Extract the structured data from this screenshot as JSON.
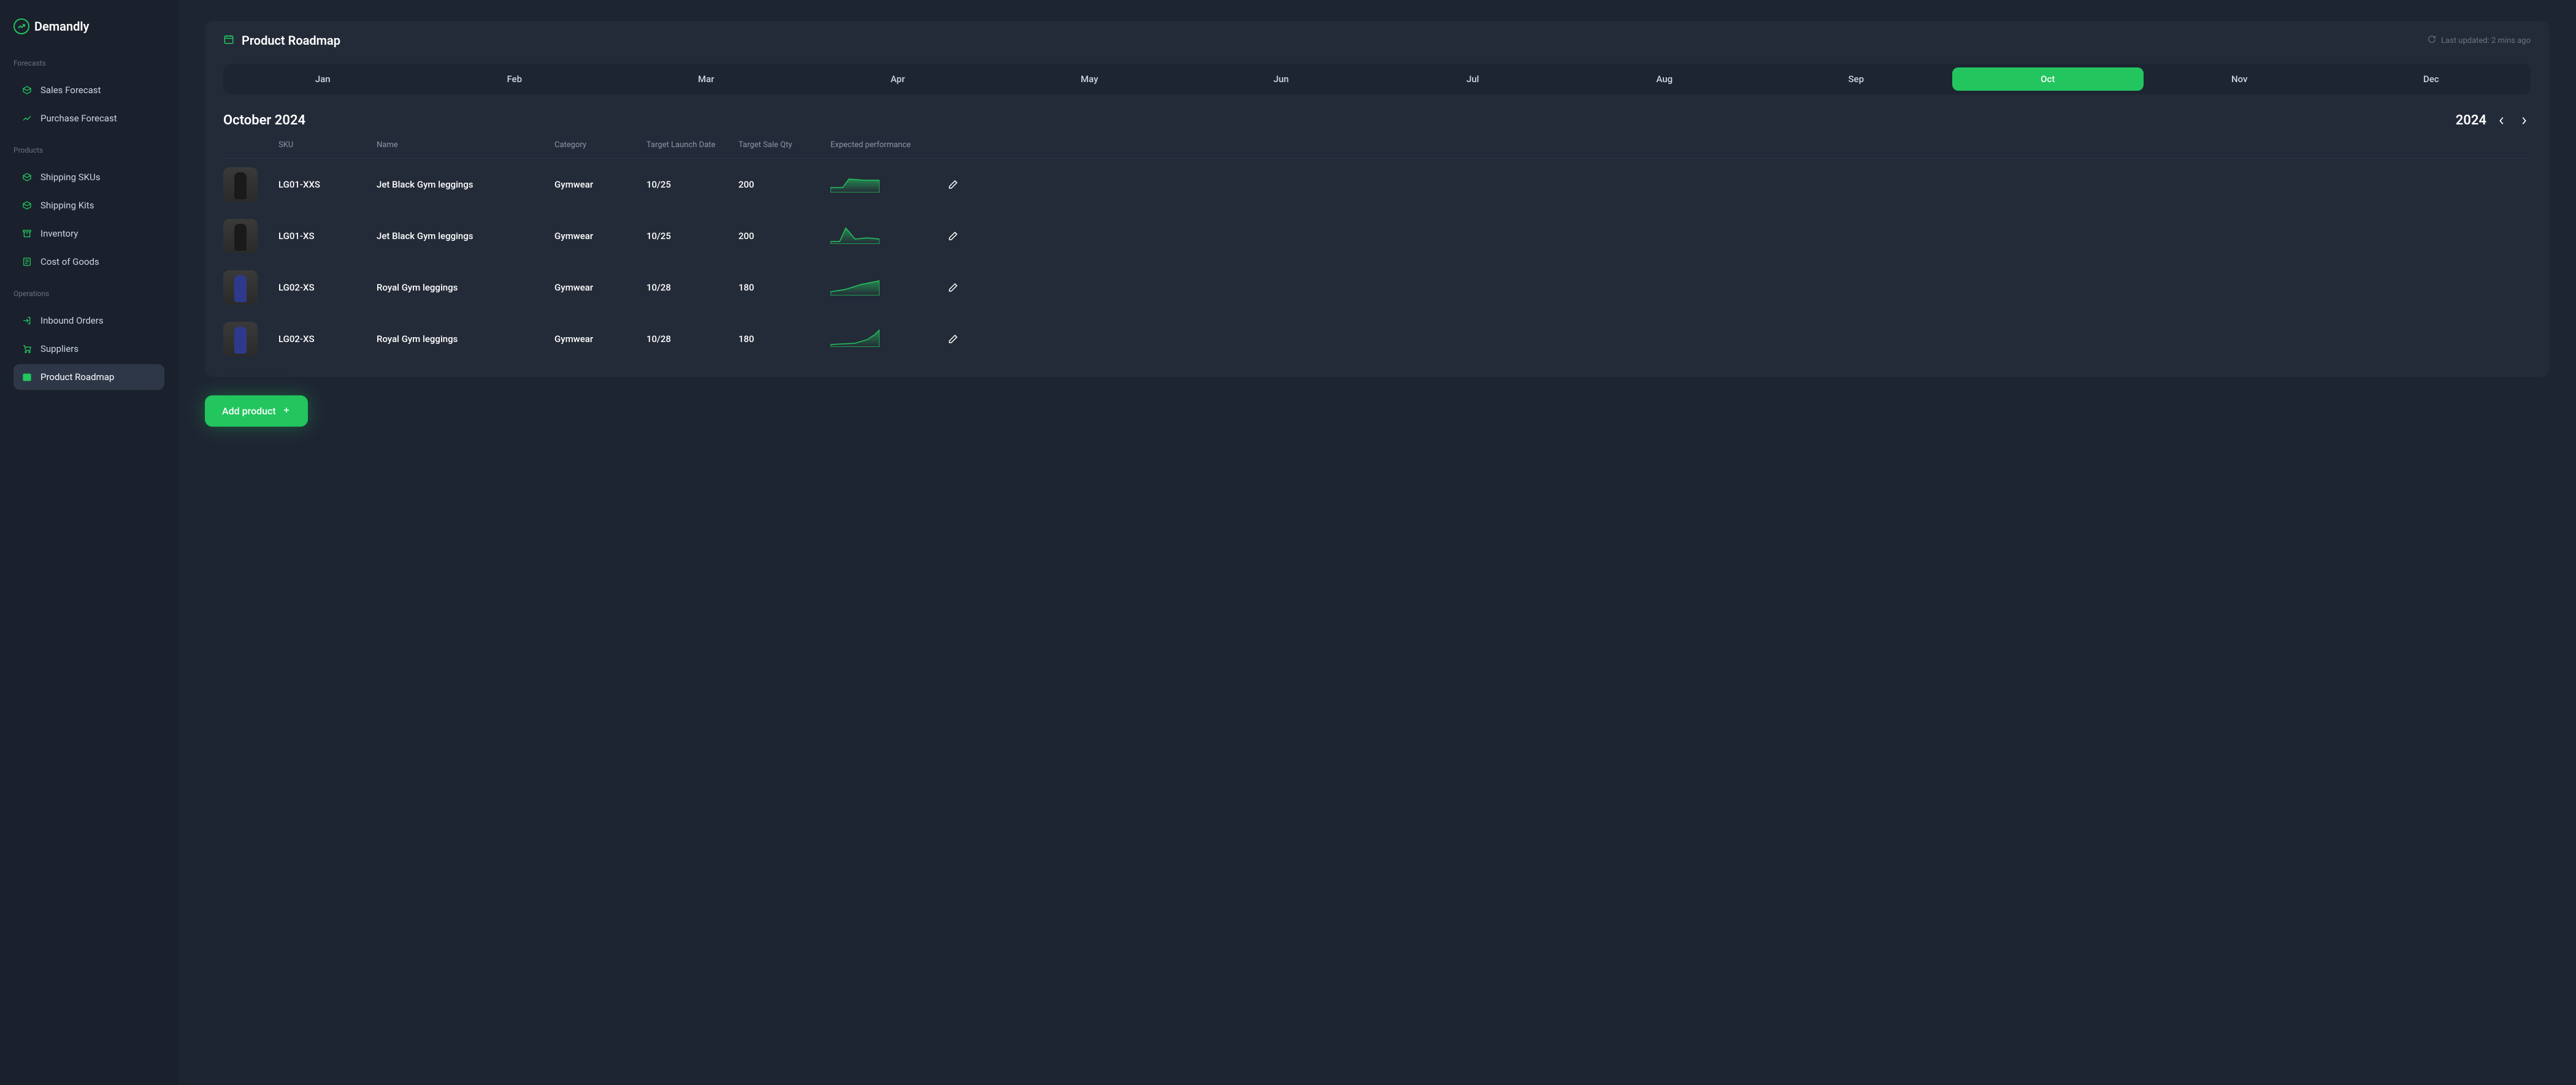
{
  "brand": "Demandly",
  "sidebar": {
    "sections": [
      {
        "label": "Forecasts",
        "items": [
          {
            "label": "Sales Forecast",
            "icon": "package-icon"
          },
          {
            "label": "Purchase Forecast",
            "icon": "trend-icon"
          }
        ]
      },
      {
        "label": "Products",
        "items": [
          {
            "label": "Shipping SKUs",
            "icon": "package-icon"
          },
          {
            "label": "Shipping Kits",
            "icon": "package-icon"
          },
          {
            "label": "Inventory",
            "icon": "archive-icon"
          },
          {
            "label": "Cost of Goods",
            "icon": "list-icon"
          }
        ]
      },
      {
        "label": "Operations",
        "items": [
          {
            "label": "Inbound Orders",
            "icon": "enter-icon"
          },
          {
            "label": "Suppliers",
            "icon": "cart-icon"
          },
          {
            "label": "Product Roadmap",
            "icon": "calendar-icon",
            "active": true
          }
        ]
      }
    ]
  },
  "header": {
    "title": "Product Roadmap",
    "updated": "Last updated: 2 mins ago"
  },
  "months": [
    "Jan",
    "Feb",
    "Mar",
    "Apr",
    "May",
    "Jun",
    "Jul",
    "Aug",
    "Sep",
    "Oct",
    "Nov",
    "Dec"
  ],
  "active_month_index": 9,
  "period_label": "October 2024",
  "year": "2024",
  "columns": [
    "",
    "SKU",
    "Name",
    "Category",
    "Target Launch Date",
    "Target Sale Qty",
    "Expected performance",
    ""
  ],
  "rows": [
    {
      "sku": "LG01-XXS",
      "name": "Jet Black Gym leggings",
      "category": "Gymwear",
      "date": "10/25",
      "qty": "200",
      "thumb": "black",
      "spark": "flat-rise"
    },
    {
      "sku": "LG01-XS",
      "name": "Jet Black Gym leggings",
      "category": "Gymwear",
      "date": "10/25",
      "qty": "200",
      "thumb": "black",
      "spark": "spike"
    },
    {
      "sku": "LG02-XS",
      "name": "Royal Gym leggings",
      "category": "Gymwear",
      "date": "10/28",
      "qty": "180",
      "thumb": "blue",
      "spark": "rise"
    },
    {
      "sku": "LG02-XS",
      "name": "Royal Gym leggings",
      "category": "Gymwear",
      "date": "10/28",
      "qty": "180",
      "thumb": "blue",
      "spark": "exp"
    }
  ],
  "add_button": "Add product",
  "colors": {
    "accent": "#22c55e"
  }
}
